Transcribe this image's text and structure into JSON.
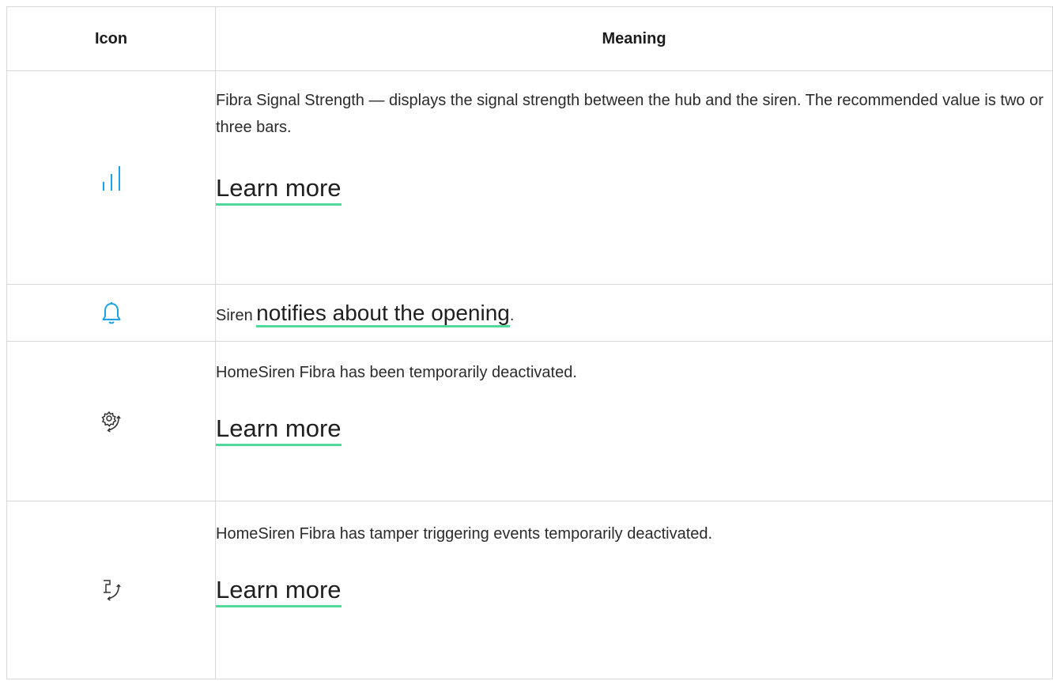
{
  "table": {
    "header": {
      "icon": "Icon",
      "meaning": "Meaning"
    },
    "rows": [
      {
        "icon": "signal-strength-icon",
        "text": "Fibra Signal Strength — displays the signal strength between the hub and the siren. The recommended value is two or three bars.",
        "link": "Learn more"
      },
      {
        "icon": "bell-icon",
        "text_before": "Siren",
        "link": "notifies about the opening",
        "text_after": "."
      },
      {
        "icon": "gear-deactivated-icon",
        "text": "HomeSiren Fibra has been temporarily deactivated.",
        "link": "Learn more"
      },
      {
        "icon": "tamper-deactivated-icon",
        "text": "HomeSiren Fibra has tamper triggering events temporarily deactivated.",
        "link": "Learn more"
      }
    ]
  },
  "colors": {
    "accent_icon": "#1aa3e8",
    "link_underline": "#4fd99a",
    "border": "#d8d8d8"
  }
}
